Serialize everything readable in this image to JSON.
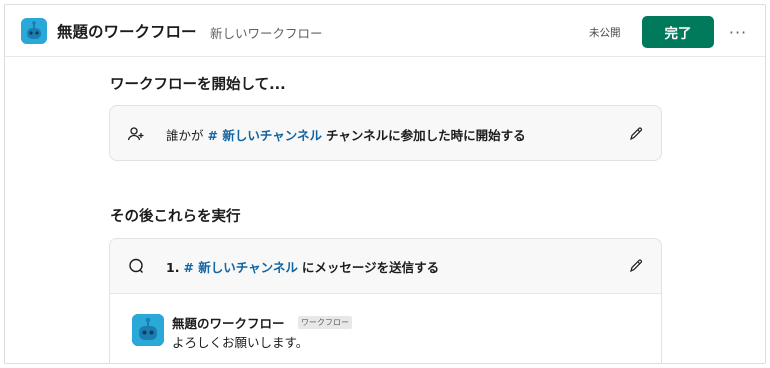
{
  "header": {
    "title": "無題のワークフロー",
    "subtitle": "新しいワークフロー",
    "status": "未公開",
    "done_label": "完了",
    "more_label": "···"
  },
  "trigger": {
    "section_title": "ワークフローを開始して...",
    "prefix": "誰かが",
    "channel": "# 新しいチャンネル",
    "suffix": "チャンネルに参加した時に開始する"
  },
  "steps": {
    "section_title": "その後これらを実行",
    "step_number": "1.",
    "channel": "# 新しいチャンネル",
    "suffix": "にメッセージを送信する",
    "message": {
      "sender": "無題のワークフロー",
      "badge": "ワークフロー",
      "body": "よろしくお願いします。"
    }
  },
  "colors": {
    "primary_button": "#007a5a",
    "channel_link": "#1264a3",
    "app_icon": "#2aa8d8"
  },
  "icons": [
    "robot-app-icon",
    "add-user-icon",
    "pencil-icon",
    "message-bubble-icon"
  ]
}
